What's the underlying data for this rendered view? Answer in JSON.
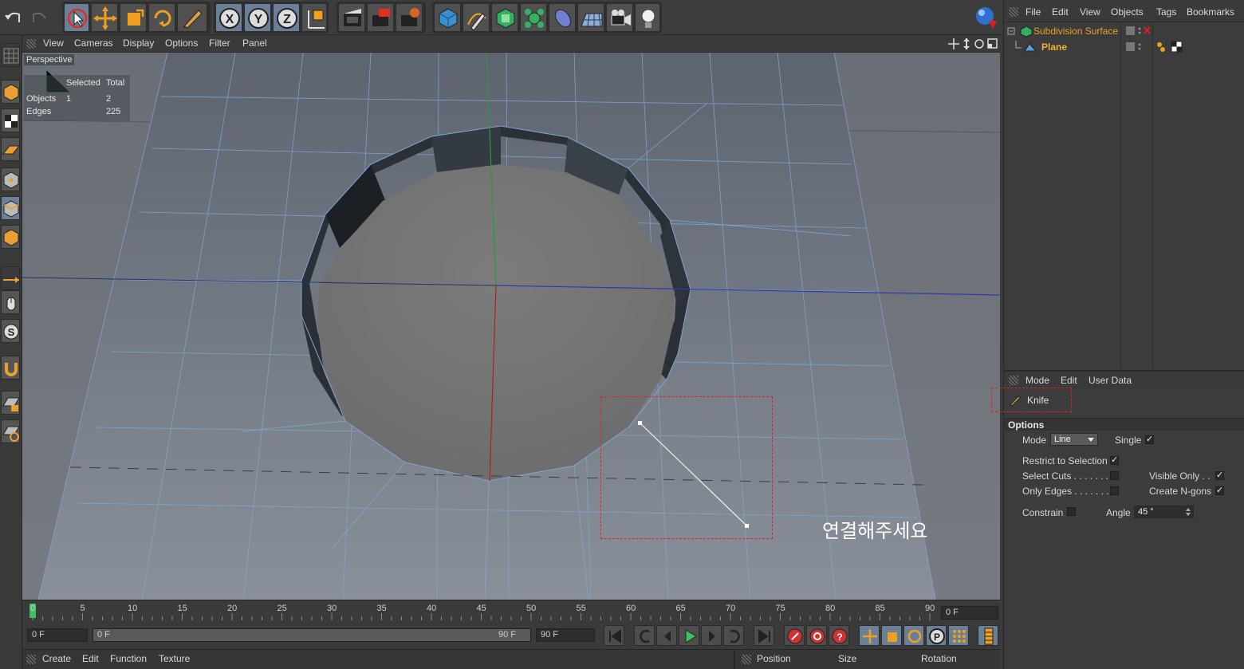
{
  "viewport_menu": [
    "View",
    "Cameras",
    "Display",
    "Options",
    "Filter",
    "Panel"
  ],
  "viewport": {
    "title": "Perspective",
    "hud": {
      "col_selected": "Selected",
      "col_total": "Total",
      "rows": [
        {
          "label": "Objects",
          "selected": "1",
          "total": "2"
        },
        {
          "label": "Edges",
          "selected": "",
          "total": "225"
        }
      ]
    },
    "annotation": "연결해주세요"
  },
  "timeline": {
    "ticks": [
      "0",
      "5",
      "10",
      "15",
      "20",
      "25",
      "30",
      "35",
      "40",
      "45",
      "50",
      "55",
      "60",
      "65",
      "70",
      "75",
      "80",
      "85",
      "90"
    ],
    "current_frame": "0 F",
    "start_field": "0 F",
    "range_start": "0 F",
    "range_end": "90 F",
    "end_field": "90 F"
  },
  "bottom_menu": [
    "Create",
    "Edit",
    "Function",
    "Texture"
  ],
  "coord_headers": [
    "Position",
    "Size",
    "Rotation"
  ],
  "object_manager": {
    "menu": [
      "File",
      "Edit",
      "View",
      "Objects",
      "Tags",
      "Bookmarks"
    ],
    "objects": [
      {
        "name": "Subdivision Surface",
        "color": "#e8a020"
      },
      {
        "name": "Plane",
        "color": "#f0b030"
      }
    ]
  },
  "attributes": {
    "menu": [
      "Mode",
      "Edit",
      "User Data"
    ],
    "tool_name": "Knife",
    "section": "Options",
    "mode_label": "Mode",
    "mode_value": "Line",
    "single_label": "Single",
    "restrict_label": "Restrict to Selection",
    "select_cuts_label": "Select Cuts . . . . . . .",
    "only_edges_label": "Only Edges . . . . . . . .",
    "visible_only_label": "Visible Only  . .",
    "create_ngons_label": "Create N-gons",
    "constrain_label": "Constrain",
    "angle_label": "Angle",
    "angle_value": "45 °",
    "check_mark": "✓"
  },
  "colors": {
    "accent_highlight": "#e02020",
    "selected_button": "#6a7f98",
    "object_name": "#f0b030"
  }
}
